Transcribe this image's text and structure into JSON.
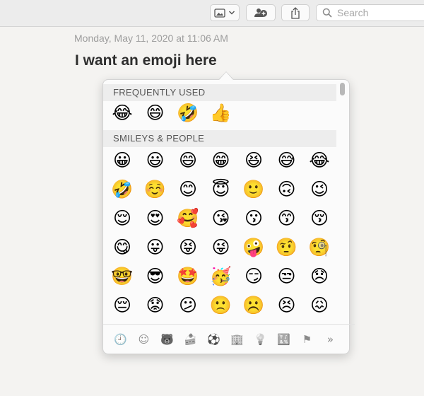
{
  "toolbar": {
    "search_placeholder": "Search"
  },
  "note": {
    "date": "Monday, May 11, 2020 at 11:06 AM",
    "title": "I want an emoji here"
  },
  "emoji_picker": {
    "frequently_used": {
      "header": "FREQUENTLY USED",
      "emojis": [
        "😂",
        "😄",
        "🤣",
        "👍"
      ]
    },
    "smileys_people": {
      "header": "SMILEYS & PEOPLE",
      "rows": [
        [
          "😀",
          "😃",
          "😄",
          "😁",
          "😆",
          "😅",
          "😂"
        ],
        [
          "🤣",
          "☺️",
          "😊",
          "😇",
          "🙂",
          "🙃",
          "😉"
        ],
        [
          "😌",
          "😍",
          "🥰",
          "😘",
          "😗",
          "😙",
          "😚"
        ],
        [
          "😋",
          "😛",
          "😝",
          "😜",
          "🤪",
          "🤨",
          "🧐"
        ],
        [
          "🤓",
          "😎",
          "🤩",
          "🥳",
          "😏",
          "😒",
          "😞"
        ],
        [
          "😔",
          "😟",
          "😕",
          "🙁",
          "☹️",
          "😣",
          "😖"
        ],
        [
          "😫",
          "😩",
          "🥺",
          "😢",
          "😭",
          "😤",
          "😠"
        ]
      ]
    },
    "categories": [
      {
        "name": "recent",
        "glyph": "🕘",
        "active": true
      },
      {
        "name": "smileys",
        "glyph": "☺",
        "active": false
      },
      {
        "name": "animals",
        "glyph": "🐻",
        "active": false
      },
      {
        "name": "food",
        "glyph": "🍰",
        "active": false
      },
      {
        "name": "activity",
        "glyph": "⚽",
        "active": false
      },
      {
        "name": "travel",
        "glyph": "🏢",
        "active": false
      },
      {
        "name": "objects",
        "glyph": "💡",
        "active": false
      },
      {
        "name": "symbols",
        "glyph": "🔣",
        "active": false
      },
      {
        "name": "flags",
        "glyph": "⚑",
        "active": false
      },
      {
        "name": "more",
        "glyph": "»",
        "active": false
      }
    ]
  }
}
